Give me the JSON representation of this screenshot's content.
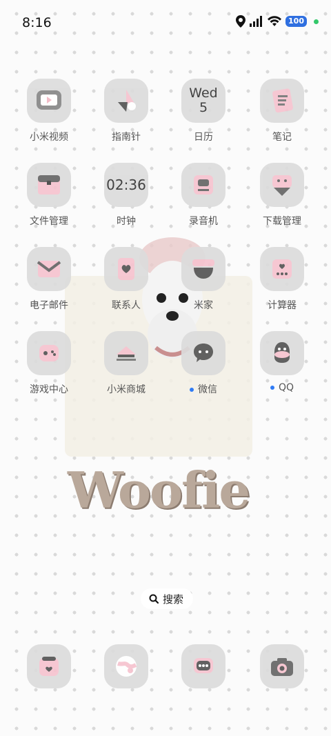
{
  "status_bar": {
    "time": "8:16",
    "battery": "100"
  },
  "apps": [
    {
      "label": "小米视频",
      "icon": "video-icon"
    },
    {
      "label": "指南针",
      "icon": "compass-icon"
    },
    {
      "label": "日历",
      "icon": "calendar-icon",
      "day": "Wed",
      "date": "5"
    },
    {
      "label": "笔记",
      "icon": "notes-icon"
    },
    {
      "label": "文件管理",
      "icon": "folder-icon"
    },
    {
      "label": "时钟",
      "icon": "clock-icon",
      "time": "02:36"
    },
    {
      "label": "录音机",
      "icon": "recorder-icon"
    },
    {
      "label": "下载管理",
      "icon": "download-icon"
    },
    {
      "label": "电子邮件",
      "icon": "mail-icon"
    },
    {
      "label": "联系人",
      "icon": "contacts-icon"
    },
    {
      "label": "米家",
      "icon": "mijia-icon"
    },
    {
      "label": "计算器",
      "icon": "calculator-icon"
    },
    {
      "label": "游戏中心",
      "icon": "game-icon"
    },
    {
      "label": "小米商城",
      "icon": "store-icon"
    },
    {
      "label": "微信",
      "icon": "wechat-icon",
      "badge": true
    },
    {
      "label": "QQ",
      "icon": "qq-icon",
      "badge": true
    }
  ],
  "search": {
    "label": "搜索"
  },
  "wallpaper": {
    "text": "Woofie"
  },
  "dock": [
    {
      "icon": "phone-icon"
    },
    {
      "icon": "browser-icon"
    },
    {
      "icon": "messages-icon"
    },
    {
      "icon": "camera-icon"
    }
  ]
}
